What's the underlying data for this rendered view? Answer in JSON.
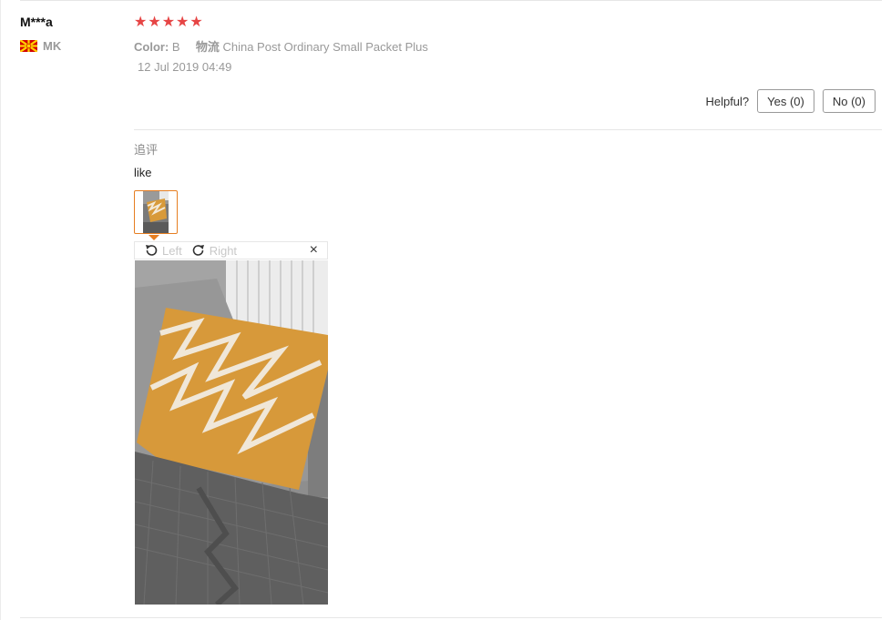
{
  "review": {
    "user": "M***a",
    "country_code": "MK",
    "rating": 5,
    "color_label": "Color:",
    "color_value": "B",
    "shipping_label": "物流",
    "shipping_value": "China Post Ordinary Small Packet Plus",
    "date": "12 Jul 2019 04:49",
    "helpful_label": "Helpful?",
    "yes_label": "Yes (0)",
    "no_label": "No (0)",
    "followup_label": "追评",
    "followup_text": "like"
  },
  "viewer": {
    "rotate_left_label": "Left",
    "rotate_right_label": "Right",
    "close_label": "×"
  },
  "icons": {
    "star": "star-icon",
    "flag": "flag-mk-icon",
    "rotate_left": "rotate-left-icon",
    "rotate_right": "rotate-right-icon",
    "close": "close-icon"
  },
  "colors": {
    "star": "#e64545",
    "accent": "#e67e22",
    "muted_text": "#999999"
  }
}
